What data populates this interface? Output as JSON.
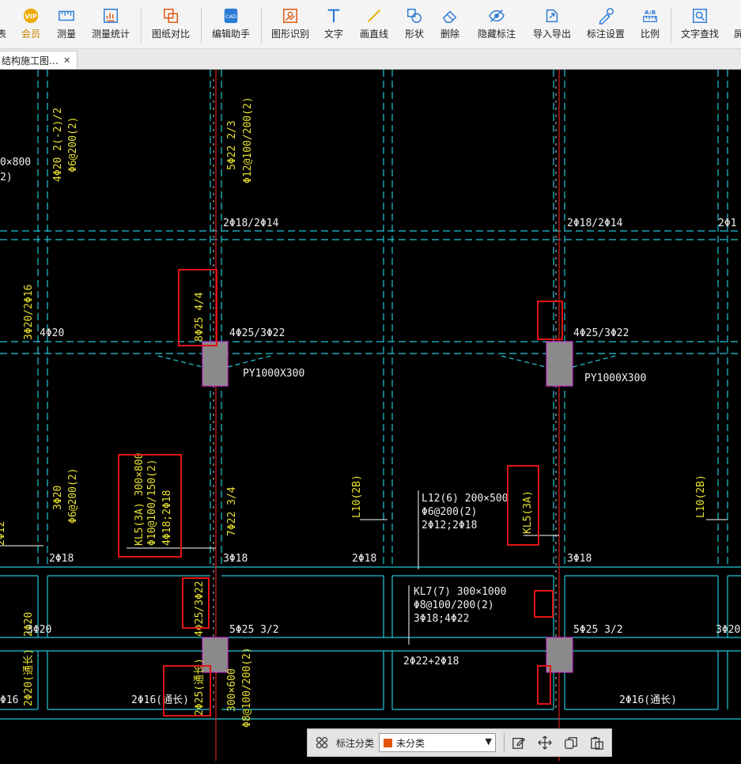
{
  "toolbar": {
    "items": [
      {
        "label": "表",
        "icon": "cropped-icon"
      },
      {
        "label": "会员",
        "icon": "vip-icon"
      },
      {
        "label": "测量",
        "icon": "ruler-icon"
      },
      {
        "label": "测量统计",
        "icon": "measure-stats-icon"
      },
      {
        "label": "图纸对比",
        "icon": "compare-icon"
      },
      {
        "label": "编辑助手",
        "icon": "edit-assistant-icon"
      },
      {
        "label": "图形识别",
        "icon": "shape-recognize-icon"
      },
      {
        "label": "文字",
        "icon": "text-icon"
      },
      {
        "label": "画直线",
        "icon": "line-icon"
      },
      {
        "label": "形状",
        "icon": "shape-icon"
      },
      {
        "label": "删除",
        "icon": "eraser-icon"
      },
      {
        "label": "隐藏标注",
        "icon": "eye-hide-icon"
      },
      {
        "label": "导入导出",
        "icon": "import-export-icon"
      },
      {
        "label": "标注设置",
        "icon": "annotation-settings-icon"
      },
      {
        "label": "比例",
        "icon": "scale-icon"
      },
      {
        "label": "文字查找",
        "icon": "text-search-icon"
      },
      {
        "label": "屏",
        "icon": "cropped-icon"
      }
    ]
  },
  "tab": {
    "title": "结构施工图…",
    "close": "✕"
  },
  "drawing": {
    "labels": {
      "l1": "4Φ20 2(-2)/2",
      "l2": "Φ6@200(2)",
      "l3": "0×800",
      "l4": "2)",
      "l5": "5Φ22 2/3",
      "l6": "Φ12@100/200(2)",
      "l7": "2Φ18/2Φ14",
      "l8": "2Φ18/2Φ14",
      "l9": "2Φ1",
      "l10": "3Φ20/2Φ16",
      "l11": "4Φ20",
      "l12": "8Φ25 4/4",
      "l13": "4Φ25/3Φ22",
      "l14": "4Φ25/3Φ22",
      "l15": "PY1000X300",
      "l16": "PY1000X300",
      "l17": "3Φ20",
      "l18": "Φ6@200(2)",
      "l19": "KL5(3A) 300×800",
      "l20": "Φ10@100/150(2)",
      "l21": "4Φ18;2Φ18",
      "l22": "7Φ22 3/4",
      "l23": "L10(2B)",
      "l24": "L10(2B)",
      "l25": "L12(6) 200×500",
      "l26": "Φ6@200(2)",
      "l27": "2Φ12;2Φ18",
      "l28": "KL5(3A)",
      "l29": "2Φ18",
      "l30": "3Φ18",
      "l31": "2Φ18",
      "l32": "3Φ18",
      "l33": "2Φ12",
      "l34": "KL7(7) 300×1000",
      "l35": "Φ8@100/200(2)",
      "l36": "3Φ18;4Φ22",
      "l37": "2Φ20",
      "l38": "3Φ20",
      "l39": "4Φ25/3Φ22",
      "l40": "5Φ25 3/2",
      "l41": "5Φ25 3/2",
      "l42": "3Φ20",
      "l43": "2Φ22+2Φ18",
      "l44": "2Φ20(通长)",
      "l45": "Φ16",
      "l46": "2Φ16(通长)",
      "l47": "2Φ25(通长)",
      "l48": "300×600",
      "l49": "Φ8@100/200(2)",
      "l50": "2Φ16(通长)"
    }
  },
  "bottom": {
    "category_label": "标注分类",
    "category_value": "未分类"
  }
}
